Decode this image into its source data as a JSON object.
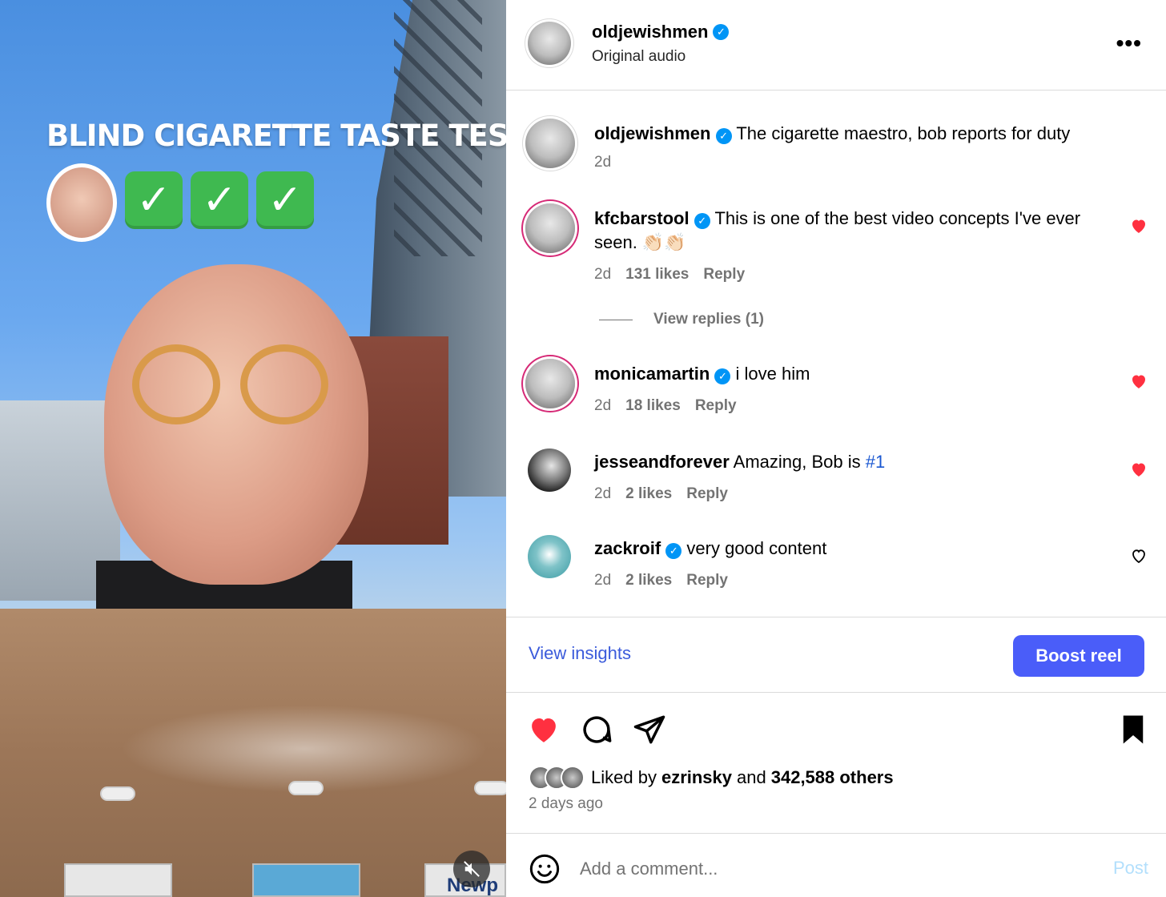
{
  "video": {
    "overlay_title": "BLIND CIGARETTE TASTE TEST",
    "check_marks": [
      "✓",
      "✓",
      "✓"
    ],
    "mute_icon": "speaker-muted-icon",
    "pack_text": "Newp"
  },
  "header": {
    "username": "oldjewishmen",
    "verified": "✓",
    "subtitle": "Original audio",
    "more": "•••"
  },
  "comments": [
    {
      "username": "oldjewishmen",
      "text": "The cigarette maestro, bob reports for duty",
      "time": "2d",
      "likes": "",
      "reply": "",
      "liked": null
    },
    {
      "username": "kfcbarstool",
      "text": "This is one of the best video concepts I've ever seen. 👏🏻👏🏻",
      "time": "2d",
      "likes": "131 likes",
      "reply": "Reply",
      "liked": true
    },
    {
      "username": "monicamartin",
      "text": "i love him",
      "time": "2d",
      "likes": "18 likes",
      "reply": "Reply",
      "liked": true
    },
    {
      "username": "jesseandforever",
      "text": "Amazing, Bob is ",
      "hashtag": "#1",
      "time": "2d",
      "likes": "2 likes",
      "reply": "Reply",
      "liked": true
    },
    {
      "username": "zackroif",
      "text": "very good content",
      "time": "2d",
      "likes": "2 likes",
      "reply": "Reply",
      "liked": false
    }
  ],
  "view_replies": "View replies (1)",
  "insights": {
    "view_label": "View insights",
    "boost_label": "Boost reel"
  },
  "liked_by": {
    "prefix": "Liked by",
    "user": "ezrinsky",
    "conj": "and",
    "others": "342,588 others",
    "time_ago": "2 days ago"
  },
  "add_comment": {
    "placeholder": "Add a comment...",
    "post_label": "Post"
  },
  "colors": {
    "accent_blue": "#0095f6",
    "boost_bg": "#4a5df9",
    "heart_red": "#ff3040",
    "insights_link": "#3b5bdb"
  }
}
